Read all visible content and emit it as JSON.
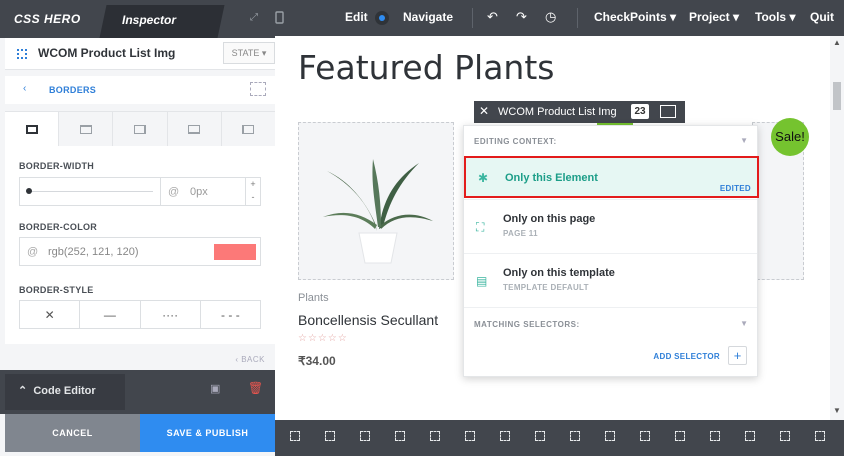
{
  "sidebar": {
    "logo": "CSS HERO",
    "tab_inspector": "Inspector",
    "element_name": "WCOM Product List Img",
    "state_button": "STATE ▾",
    "section_title": "BORDERS",
    "border_width": {
      "label": "BORDER-WIDTH",
      "at": "@",
      "value": "0px",
      "stepper": "+\n-"
    },
    "border_color": {
      "label": "BORDER-COLOR",
      "at": "@",
      "value": "rgb(252, 121, 120)",
      "swatch_color": "#fc7978"
    },
    "border_style": {
      "label": "BORDER-STYLE",
      "options": [
        "✕",
        "—",
        "····",
        "- - -"
      ]
    },
    "back_label": "BACK",
    "code_editor_label": "Code Editor",
    "cancel_label": "CANCEL",
    "publish_label": "SAVE & PUBLISH"
  },
  "topbar": {
    "edit_label": "Edit",
    "navigate_label": "Navigate",
    "menu": [
      "CheckPoints ▾",
      "Project ▾",
      "Tools ▾",
      "Quit"
    ]
  },
  "canvas": {
    "title": "Featured Plants",
    "product": {
      "category": "Plants",
      "name": "Boncellensis Secullant",
      "stars": "☆☆☆☆☆",
      "price": "₹34.00"
    },
    "sale_badge": "Sale!"
  },
  "element_bar": {
    "name": "WCOM Product List Img",
    "count": "23"
  },
  "popup": {
    "context_label": "EDITING CONTEXT:",
    "options": [
      {
        "title": "Only this Element",
        "sub": "",
        "badge": "EDITED"
      },
      {
        "title": "Only on this page",
        "sub": "PAGE 11"
      },
      {
        "title": "Only on this template",
        "sub": "TEMPLATE DEFAULT"
      }
    ],
    "matching_label": "MATCHING SELECTORS:",
    "add_selector_label": "ADD SELECTOR",
    "add_selector_btn": "+"
  },
  "colors": {
    "accent_blue": "#2f8cf0",
    "dark_bar": "#42464d",
    "teal": "#1c9e88",
    "highlight_red": "#e31b1b",
    "sale_green": "#75c32f"
  }
}
